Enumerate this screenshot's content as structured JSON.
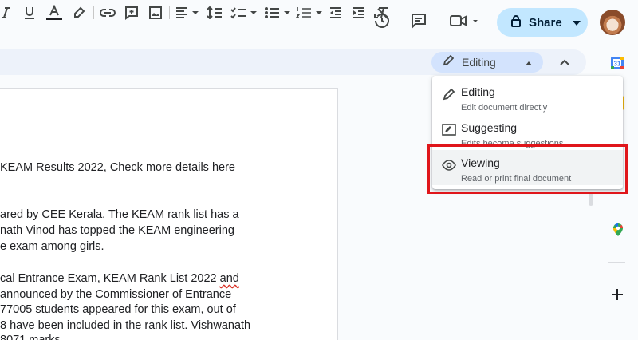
{
  "header": {
    "share_label": "Share",
    "icons": [
      "history-icon",
      "comment-icon",
      "meet-icon",
      "lock-icon",
      "avatar"
    ]
  },
  "toolbar": {
    "mode_label": "Editing",
    "buttons": [
      "italic",
      "underline",
      "text-color",
      "highlight",
      "link",
      "comment",
      "image",
      "align",
      "line-spacing",
      "checklist",
      "bulleted-list",
      "numbered-list",
      "decrease-indent",
      "increase-indent",
      "clear-formatting"
    ]
  },
  "document": {
    "lines": [
      "KEAM Results 2022, Check  more details here",
      "ared by CEE Kerala. The KEAM rank list has a",
      "nath Vinod has topped the KEAM engineering",
      "e exam among girls.",
      "cal Entrance Exam, KEAM Rank List 2022",
      "and",
      "announced by the Commissioner of Entrance",
      "77005 students appeared for this exam, out of",
      "8 have been included in the rank list. Vishwanath",
      "8071 marks"
    ]
  },
  "mode_menu": {
    "items": [
      {
        "title": "Editing",
        "desc": "Edit document directly"
      },
      {
        "title": "Suggesting",
        "desc": "Edits become suggestions"
      },
      {
        "title": "Viewing",
        "desc": "Read or print final document"
      }
    ]
  },
  "colors": {
    "accent": "#c2e7ff",
    "toolbar_bg": "#edf2fa",
    "highlight": "#e0161b",
    "spell_error": "#d93025"
  }
}
